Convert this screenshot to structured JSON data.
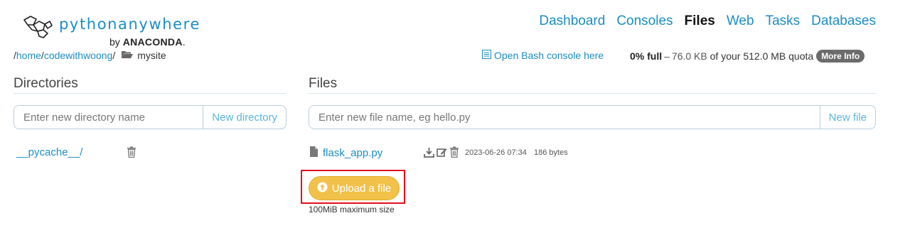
{
  "logo": {
    "name": "pythonanywhere",
    "by": "by",
    "brand": "ANACONDA",
    "brand_suffix": "."
  },
  "nav": [
    {
      "label": "Dashboard",
      "active": false
    },
    {
      "label": "Consoles",
      "active": false
    },
    {
      "label": "Files",
      "active": true
    },
    {
      "label": "Web",
      "active": false
    },
    {
      "label": "Tasks",
      "active": false
    },
    {
      "label": "Databases",
      "active": false
    }
  ],
  "breadcrumb": {
    "sep": "/",
    "home": "home",
    "user": "codewithwoong",
    "current": "mysite"
  },
  "bash_link": "Open Bash console here",
  "quota": {
    "percent": "0% full",
    "dash": "–",
    "used": "76.0 KB",
    "of_text": "of your 512.0 MB quota",
    "more_info": "More Info"
  },
  "directories": {
    "title": "Directories",
    "input_placeholder": "Enter new directory name",
    "button": "New directory",
    "items": [
      {
        "name": "__pycache__/"
      }
    ]
  },
  "files": {
    "title": "Files",
    "input_placeholder": "Enter new file name, eg hello.py",
    "button": "New file",
    "items": [
      {
        "name": "flask_app.py",
        "date": "2023-06-26 07:34",
        "size": "186 bytes"
      }
    ],
    "upload_button": "Upload a file",
    "max_size": "100MiB maximum size"
  },
  "colors": {
    "link": "#1b8dc3",
    "upload": "#f2c14a",
    "highlight": "#e1101c"
  }
}
